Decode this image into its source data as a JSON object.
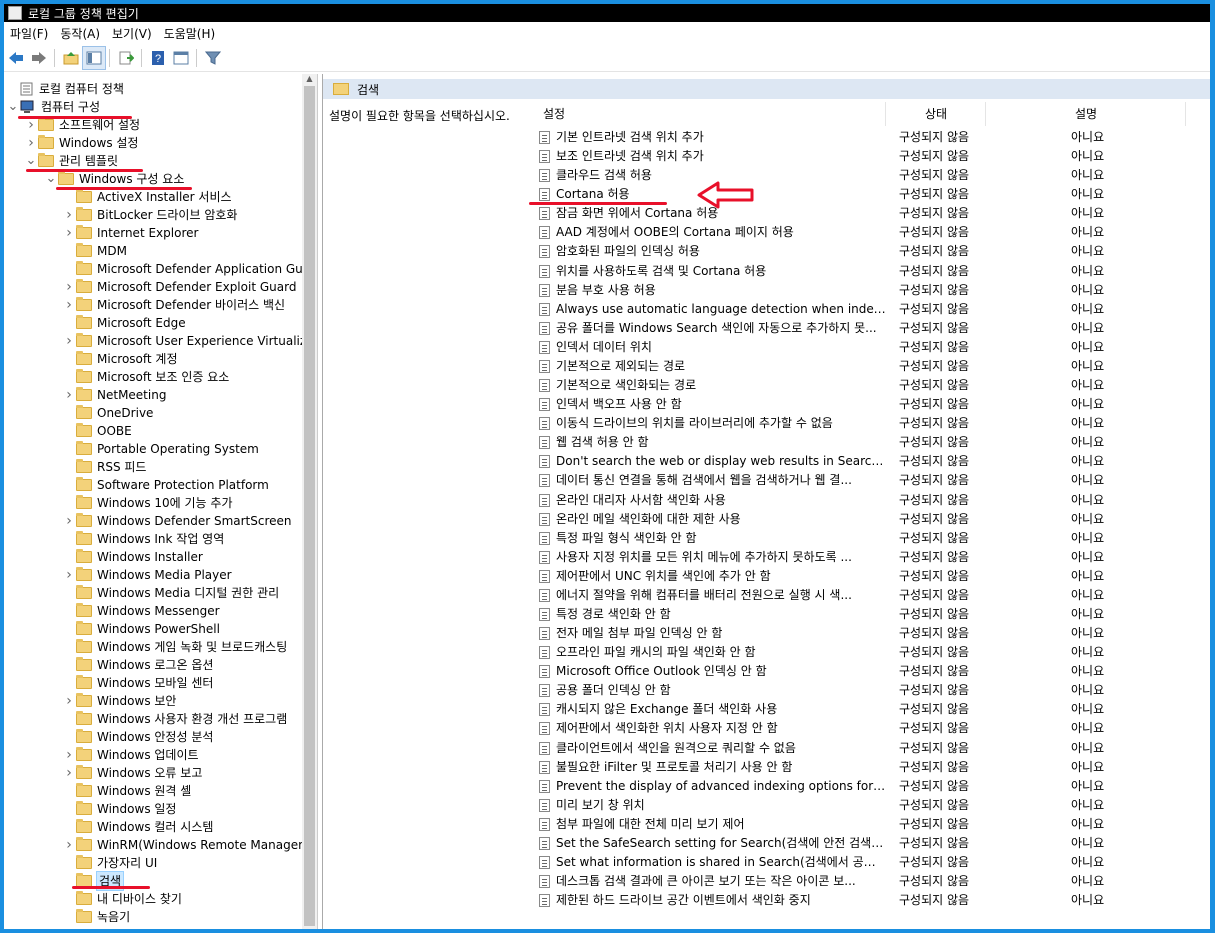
{
  "window": {
    "title": "로컬 그룹 정책 편집기"
  },
  "menu": [
    "파일(F)",
    "동작(A)",
    "보기(V)",
    "도움말(H)"
  ],
  "toolbar_icons": [
    "back-icon",
    "forward-icon",
    "up-folder-icon",
    "show-hide-tree-icon",
    "export-list-icon",
    "help-icon",
    "properties-icon",
    "filter-icon"
  ],
  "tree": [
    {
      "label": "로컬 컴퓨터 정책",
      "level": 0,
      "arrow": "",
      "icon": "policy"
    },
    {
      "label": "컴퓨터 구성",
      "level": 0,
      "arrow": "v",
      "icon": "pc"
    },
    {
      "label": "소프트웨어 설정",
      "level": 1,
      "arrow": ">",
      "icon": "folder"
    },
    {
      "label": "Windows 설정",
      "level": 1,
      "arrow": ">",
      "icon": "folder"
    },
    {
      "label": "관리 템플릿",
      "level": 1,
      "arrow": "v",
      "icon": "folder"
    },
    {
      "label": "Windows 구성 요소",
      "level": 2,
      "arrow": "v",
      "icon": "folder"
    },
    {
      "label": "ActiveX Installer 서비스",
      "level": 3,
      "arrow": "",
      "icon": "folder"
    },
    {
      "label": "BitLocker 드라이브 암호화",
      "level": 3,
      "arrow": ">",
      "icon": "folder"
    },
    {
      "label": "Internet Explorer",
      "level": 3,
      "arrow": ">",
      "icon": "folder"
    },
    {
      "label": "MDM",
      "level": 3,
      "arrow": "",
      "icon": "folder"
    },
    {
      "label": "Microsoft Defender Application Guar",
      "level": 3,
      "arrow": "",
      "icon": "folder"
    },
    {
      "label": "Microsoft Defender Exploit Guard",
      "level": 3,
      "arrow": ">",
      "icon": "folder"
    },
    {
      "label": "Microsoft Defender 바이러스 백신",
      "level": 3,
      "arrow": ">",
      "icon": "folder"
    },
    {
      "label": "Microsoft Edge",
      "level": 3,
      "arrow": "",
      "icon": "folder"
    },
    {
      "label": "Microsoft User Experience Virtualizat",
      "level": 3,
      "arrow": ">",
      "icon": "folder"
    },
    {
      "label": "Microsoft 계정",
      "level": 3,
      "arrow": "",
      "icon": "folder"
    },
    {
      "label": "Microsoft 보조 인증 요소",
      "level": 3,
      "arrow": "",
      "icon": "folder"
    },
    {
      "label": "NetMeeting",
      "level": 3,
      "arrow": ">",
      "icon": "folder"
    },
    {
      "label": "OneDrive",
      "level": 3,
      "arrow": "",
      "icon": "folder"
    },
    {
      "label": "OOBE",
      "level": 3,
      "arrow": "",
      "icon": "folder"
    },
    {
      "label": "Portable Operating System",
      "level": 3,
      "arrow": "",
      "icon": "folder"
    },
    {
      "label": "RSS 피드",
      "level": 3,
      "arrow": "",
      "icon": "folder"
    },
    {
      "label": "Software Protection Platform",
      "level": 3,
      "arrow": "",
      "icon": "folder"
    },
    {
      "label": "Windows 10에 기능 추가",
      "level": 3,
      "arrow": "",
      "icon": "folder"
    },
    {
      "label": "Windows Defender SmartScreen",
      "level": 3,
      "arrow": ">",
      "icon": "folder"
    },
    {
      "label": "Windows Ink 작업 영역",
      "level": 3,
      "arrow": "",
      "icon": "folder"
    },
    {
      "label": "Windows Installer",
      "level": 3,
      "arrow": "",
      "icon": "folder"
    },
    {
      "label": "Windows Media Player",
      "level": 3,
      "arrow": ">",
      "icon": "folder"
    },
    {
      "label": "Windows Media 디지털 권한 관리",
      "level": 3,
      "arrow": "",
      "icon": "folder"
    },
    {
      "label": "Windows Messenger",
      "level": 3,
      "arrow": "",
      "icon": "folder"
    },
    {
      "label": "Windows PowerShell",
      "level": 3,
      "arrow": "",
      "icon": "folder"
    },
    {
      "label": "Windows 게임 녹화 및 브로드캐스팅",
      "level": 3,
      "arrow": "",
      "icon": "folder"
    },
    {
      "label": "Windows 로그온 옵션",
      "level": 3,
      "arrow": "",
      "icon": "folder"
    },
    {
      "label": "Windows 모바일 센터",
      "level": 3,
      "arrow": "",
      "icon": "folder"
    },
    {
      "label": "Windows 보안",
      "level": 3,
      "arrow": ">",
      "icon": "folder"
    },
    {
      "label": "Windows 사용자 환경 개선 프로그램",
      "level": 3,
      "arrow": "",
      "icon": "folder"
    },
    {
      "label": "Windows 안정성 분석",
      "level": 3,
      "arrow": "",
      "icon": "folder"
    },
    {
      "label": "Windows 업데이트",
      "level": 3,
      "arrow": ">",
      "icon": "folder"
    },
    {
      "label": "Windows 오류 보고",
      "level": 3,
      "arrow": ">",
      "icon": "folder"
    },
    {
      "label": "Windows 원격 셸",
      "level": 3,
      "arrow": "",
      "icon": "folder"
    },
    {
      "label": "Windows 일정",
      "level": 3,
      "arrow": "",
      "icon": "folder"
    },
    {
      "label": "Windows 컬러 시스템",
      "level": 3,
      "arrow": "",
      "icon": "folder"
    },
    {
      "label": "WinRM(Windows Remote Manageme",
      "level": 3,
      "arrow": ">",
      "icon": "folder"
    },
    {
      "label": "가장자리 UI",
      "level": 3,
      "arrow": "",
      "icon": "folder"
    },
    {
      "label": "검색",
      "level": 3,
      "arrow": "",
      "icon": "folder",
      "selected": true
    },
    {
      "label": "내 디바이스 찾기",
      "level": 3,
      "arrow": "",
      "icon": "folder"
    },
    {
      "label": "녹음기",
      "level": 3,
      "arrow": "",
      "icon": "folder"
    }
  ],
  "right": {
    "header": "검색",
    "description": "설명이 필요한 항목을 선택하십시오.",
    "columns": {
      "setting": "설정",
      "state": "상태",
      "comment": "설명"
    },
    "rows": [
      {
        "name": "기본 인트라넷 검색 위치 추가",
        "state": "구성되지 않음",
        "comment": "아니요"
      },
      {
        "name": "보조 인트라넷 검색 위치 추가",
        "state": "구성되지 않음",
        "comment": "아니요"
      },
      {
        "name": "클라우드 검색 허용",
        "state": "구성되지 않음",
        "comment": "아니요"
      },
      {
        "name": "Cortana 허용",
        "state": "구성되지 않음",
        "comment": "아니요"
      },
      {
        "name": "잠금 화면 위에서 Cortana 허용",
        "state": "구성되지 않음",
        "comment": "아니요"
      },
      {
        "name": "AAD 계정에서 OOBE의 Cortana 페이지 허용",
        "state": "구성되지 않음",
        "comment": "아니요"
      },
      {
        "name": "암호화된 파일의 인덱싱 허용",
        "state": "구성되지 않음",
        "comment": "아니요"
      },
      {
        "name": "위치를 사용하도록 검색 및 Cortana 허용",
        "state": "구성되지 않음",
        "comment": "아니요"
      },
      {
        "name": "분음 부호 사용 허용",
        "state": "구성되지 않음",
        "comment": "아니요"
      },
      {
        "name": "Always use automatic language detection when indexing c...",
        "state": "구성되지 않음",
        "comment": "아니요"
      },
      {
        "name": "공유 폴더를 Windows Search 색인에 자동으로 추가하지 못...",
        "state": "구성되지 않음",
        "comment": "아니요"
      },
      {
        "name": "인덱서 데이터 위치",
        "state": "구성되지 않음",
        "comment": "아니요"
      },
      {
        "name": "기본적으로 제외되는 경로",
        "state": "구성되지 않음",
        "comment": "아니요"
      },
      {
        "name": "기본적으로 색인화되는 경로",
        "state": "구성되지 않음",
        "comment": "아니요"
      },
      {
        "name": "인덱서 백오프 사용 안 함",
        "state": "구성되지 않음",
        "comment": "아니요"
      },
      {
        "name": "이동식 드라이브의 위치를 라이브러리에 추가할 수 없음",
        "state": "구성되지 않음",
        "comment": "아니요"
      },
      {
        "name": "웹 검색 허용 안 함",
        "state": "구성되지 않음",
        "comment": "아니요"
      },
      {
        "name": "Don't search the web or display web results in Search(검색...",
        "state": "구성되지 않음",
        "comment": "아니요"
      },
      {
        "name": "데이터 통신 연결을 통해 검색에서 웹을 검색하거나 웹 결...",
        "state": "구성되지 않음",
        "comment": "아니요"
      },
      {
        "name": "온라인 대리자 사서함 색인화 사용",
        "state": "구성되지 않음",
        "comment": "아니요"
      },
      {
        "name": "온라인 메일 색인화에 대한 제한 사용",
        "state": "구성되지 않음",
        "comment": "아니요"
      },
      {
        "name": "특정 파일 형식 색인화 안 함",
        "state": "구성되지 않음",
        "comment": "아니요"
      },
      {
        "name": "사용자 지정 위치를 모든 위치 메뉴에 추가하지 못하도록 ...",
        "state": "구성되지 않음",
        "comment": "아니요"
      },
      {
        "name": "제어판에서 UNC 위치를 색인에 추가 안 함",
        "state": "구성되지 않음",
        "comment": "아니요"
      },
      {
        "name": "에너지 절약을 위해 컴퓨터를 배터리 전원으로 실행 시 색...",
        "state": "구성되지 않음",
        "comment": "아니요"
      },
      {
        "name": "특정 경로 색인화 안 함",
        "state": "구성되지 않음",
        "comment": "아니요"
      },
      {
        "name": "전자 메일 첨부 파일 인덱싱 안 함",
        "state": "구성되지 않음",
        "comment": "아니요"
      },
      {
        "name": "오프라인 파일 캐시의 파일 색인화 안 함",
        "state": "구성되지 않음",
        "comment": "아니요"
      },
      {
        "name": "Microsoft Office Outlook 인덱싱 안 함",
        "state": "구성되지 않음",
        "comment": "아니요"
      },
      {
        "name": "공용 폴더 인덱싱 안 함",
        "state": "구성되지 않음",
        "comment": "아니요"
      },
      {
        "name": "캐시되지 않은 Exchange 폴더 색인화 사용",
        "state": "구성되지 않음",
        "comment": "아니요"
      },
      {
        "name": "제어판에서 색인화한 위치 사용자 지정 안 함",
        "state": "구성되지 않음",
        "comment": "아니요"
      },
      {
        "name": "클라이언트에서 색인을 원격으로 쿼리할 수 없음",
        "state": "구성되지 않음",
        "comment": "아니요"
      },
      {
        "name": "불필요한 iFilter 및 프로토콜 처리기 사용 안 함",
        "state": "구성되지 않음",
        "comment": "아니요"
      },
      {
        "name": "Prevent the display of advanced indexing options for Wind...",
        "state": "구성되지 않음",
        "comment": "아니요"
      },
      {
        "name": "미리 보기 창 위치",
        "state": "구성되지 않음",
        "comment": "아니요"
      },
      {
        "name": "첨부 파일에 대한 전체 미리 보기 제어",
        "state": "구성되지 않음",
        "comment": "아니요"
      },
      {
        "name": "Set the SafeSearch setting for Search(검색에 안전 검색 설...",
        "state": "구성되지 않음",
        "comment": "아니요"
      },
      {
        "name": "Set what information is shared in Search(검색에서 공유하...",
        "state": "구성되지 않음",
        "comment": "아니요"
      },
      {
        "name": "데스크톱 검색 결과에 큰 아이콘 보기 또는 작은 아이콘 보...",
        "state": "구성되지 않음",
        "comment": "아니요"
      },
      {
        "name": "제한된 하드 드라이브 공간 이벤트에서 색인화 중지",
        "state": "구성되지 않음",
        "comment": "아니요"
      }
    ]
  },
  "colors": {
    "annotation_red": "#e8102a",
    "selection": "#cce8ff",
    "frame": "#1a8fe0"
  }
}
